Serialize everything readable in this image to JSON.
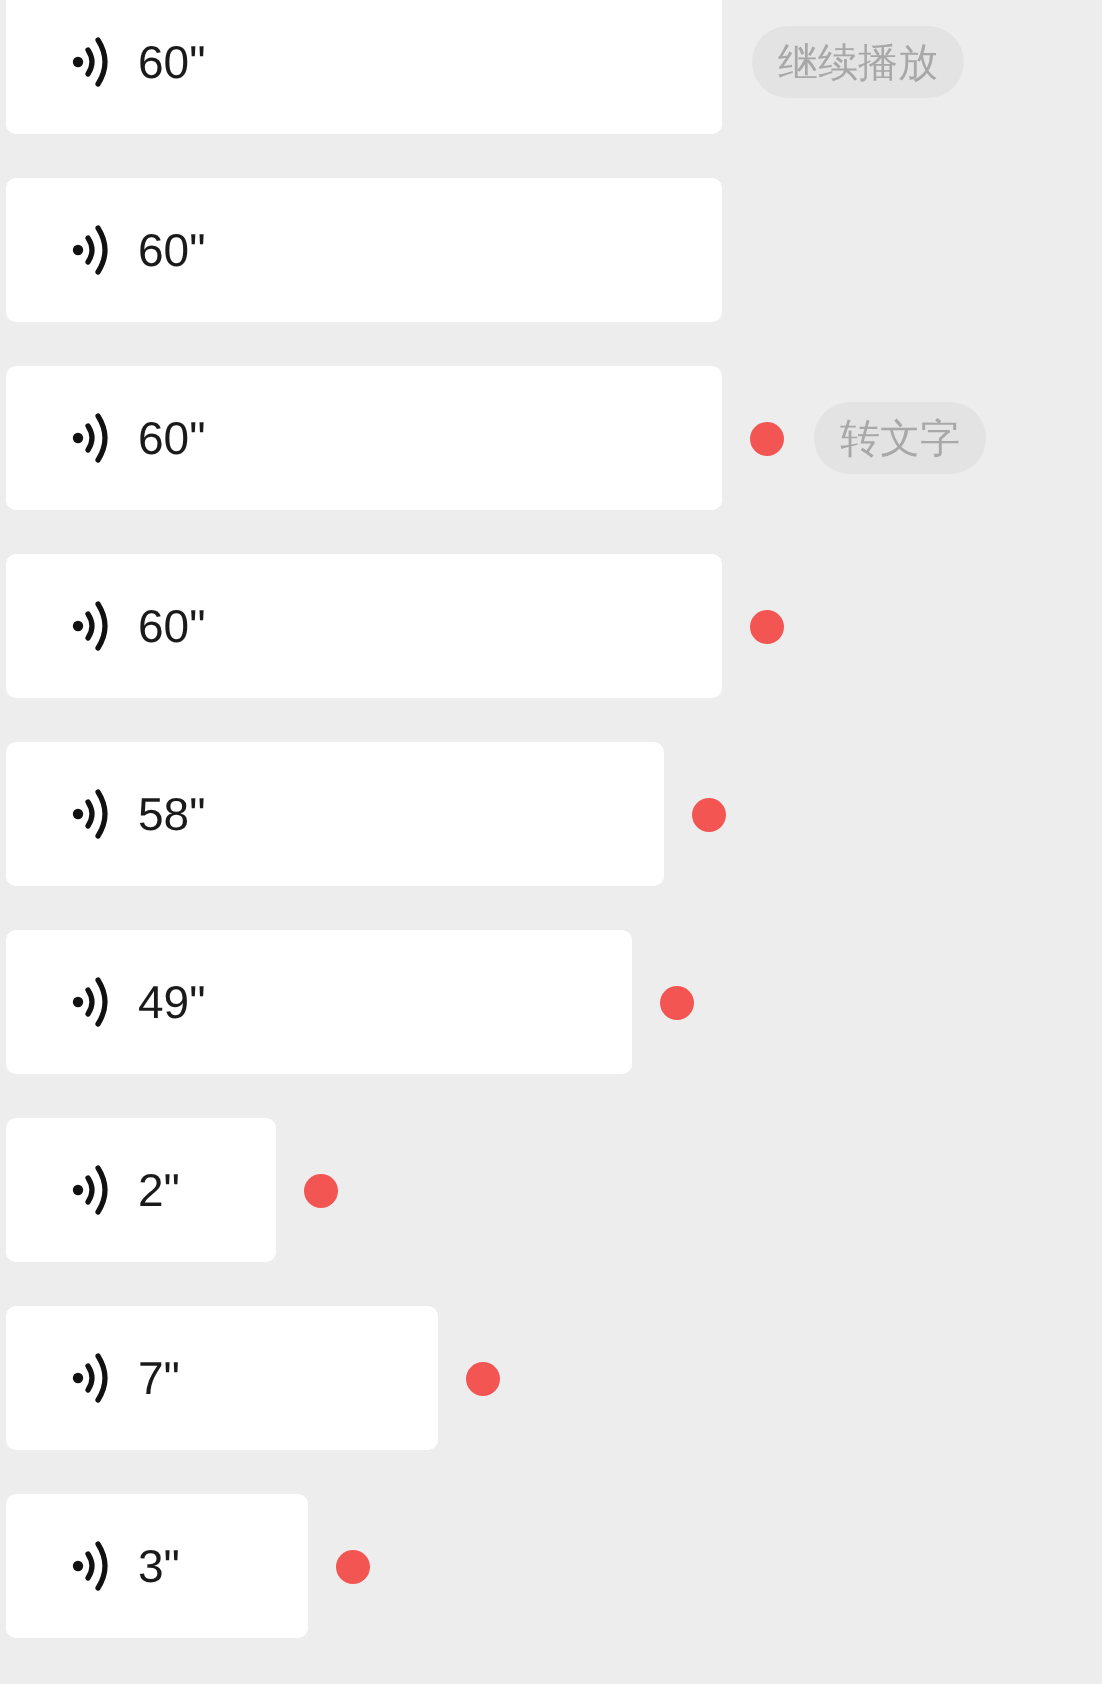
{
  "voice_messages": [
    {
      "duration": "60\"",
      "unread": false,
      "action": "继续播放"
    },
    {
      "duration": "60\"",
      "unread": false
    },
    {
      "duration": "60\"",
      "unread": true,
      "action": "转文字"
    },
    {
      "duration": "60\"",
      "unread": true
    },
    {
      "duration": "58\"",
      "unread": true
    },
    {
      "duration": "49\"",
      "unread": true
    },
    {
      "duration": "2\"",
      "unread": true
    },
    {
      "duration": "7\"",
      "unread": true
    },
    {
      "duration": "3\"",
      "unread": true
    }
  ]
}
